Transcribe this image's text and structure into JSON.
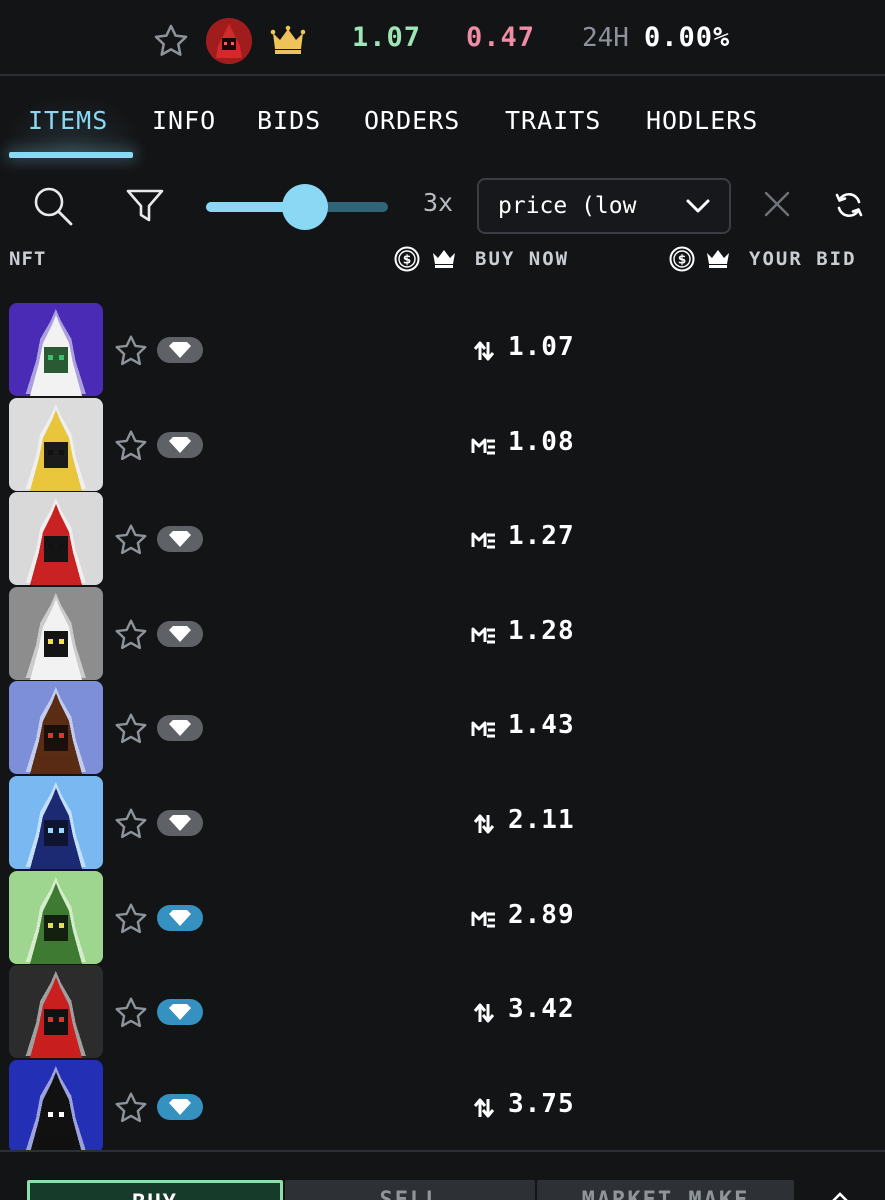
{
  "stats": {
    "favorite_icon": "star-outline-icon",
    "collection_avatar": "red-hooded-wizard-avatar",
    "crown_icon": "crown-icon",
    "value_a": "1.07",
    "value_a_color": "#9ee6b5",
    "value_b": "0.47",
    "value_b_color": "#ee8ea6",
    "change_label": "24H",
    "change_value": "0.00%"
  },
  "tabs": [
    {
      "label": "ITEMS",
      "active": true
    },
    {
      "label": "INFO",
      "active": false
    },
    {
      "label": "BIDS",
      "active": false
    },
    {
      "label": "ORDERS",
      "active": false
    },
    {
      "label": "TRAITS",
      "active": false
    },
    {
      "label": "HODLERS",
      "active": false
    }
  ],
  "toolbar": {
    "search_icon": "search-icon",
    "filter_icon": "filter-icon",
    "zoom_slider_fraction": 0.5,
    "zoom_label": "3x",
    "sort_value": "price (low",
    "clear_icon": "close-icon",
    "refresh_icon": "refresh-icon"
  },
  "columns": {
    "nft": "NFT",
    "buy_now": "BUY NOW",
    "your_bid": "YOUR BID"
  },
  "items": [
    {
      "price": "1.07",
      "marketplace_icon": "tensor-icon",
      "highlighted": false,
      "hood": "#f2f2f2",
      "bg": "#4a2bb6",
      "eyes": "#3cbf6a",
      "face": "#2a5a34"
    },
    {
      "price": "1.08",
      "marketplace_icon": "magic-eden-icon",
      "highlighted": false,
      "hood": "#e9c53c",
      "bg": "#dcdcdc",
      "eyes": "#111111",
      "face": "#1b1b1b"
    },
    {
      "price": "1.27",
      "marketplace_icon": "magic-eden-icon",
      "highlighted": false,
      "hood": "#c92222",
      "bg": "#d9d9d9",
      "eyes": "#111111",
      "face": "#141414"
    },
    {
      "price": "1.28",
      "marketplace_icon": "magic-eden-icon",
      "highlighted": false,
      "hood": "#f2f2f2",
      "bg": "#8d8d8d",
      "eyes": "#f2e04a",
      "face": "#141414"
    },
    {
      "price": "1.43",
      "marketplace_icon": "magic-eden-icon",
      "highlighted": false,
      "hood": "#5a2c14",
      "bg": "#7d8fd8",
      "eyes": "#e23232",
      "face": "#1a0f0a"
    },
    {
      "price": "2.11",
      "marketplace_icon": "tensor-icon",
      "highlighted": false,
      "hood": "#1b2a72",
      "bg": "#7ab8f2",
      "eyes": "#9ad8ff",
      "face": "#0f1430"
    },
    {
      "price": "2.89",
      "marketplace_icon": "magic-eden-icon",
      "highlighted": true,
      "hood": "#3f7a33",
      "bg": "#9fd68f",
      "eyes": "#e7e04a",
      "face": "#14200f"
    },
    {
      "price": "3.42",
      "marketplace_icon": "tensor-icon",
      "highlighted": true,
      "hood": "#c91f1f",
      "bg": "#2c2c2c",
      "eyes": "#e23232",
      "face": "#111111"
    },
    {
      "price": "3.75",
      "marketplace_icon": "tensor-icon",
      "highlighted": true,
      "hood": "#111111",
      "bg": "#232fb4",
      "eyes": "#ffffff",
      "face": "#111111"
    }
  ],
  "actions": {
    "buy": "BUY",
    "sell": "SELL",
    "market_make": "MARKET MAKE",
    "expand_icon": "chevron-up-icon"
  }
}
